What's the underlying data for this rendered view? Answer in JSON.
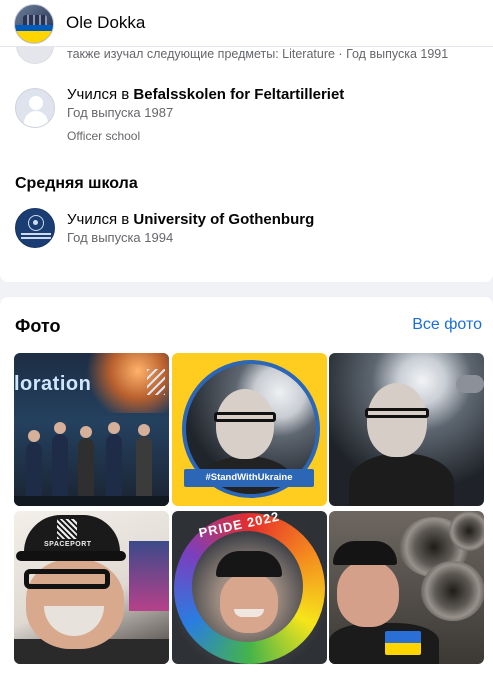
{
  "header": {
    "profile_name": "Ole Dokka"
  },
  "education": {
    "partial_item": "также изучал следующие предметы: Literature · Год выпуска 1991",
    "school_1": {
      "prefix": "Учился в ",
      "name": "Befalsskolen for Feltartilleriet",
      "year": "Год выпуска 1987",
      "note": "Officer school"
    },
    "secondary_title": "Средняя школа",
    "school_2": {
      "prefix": "Учился в ",
      "name": "University of Gothenburg",
      "year": "Год выпуска 1994"
    }
  },
  "photos": {
    "title": "Фото",
    "all_link": "Все фото",
    "items": [
      {
        "icon": "conference-photo",
        "overlay_text": "loration"
      },
      {
        "icon": "standwithukraine-portrait",
        "overlay_text": "#StandWithUkraine"
      },
      {
        "icon": "astronaut-portrait"
      },
      {
        "icon": "spaceport-cap-selfie",
        "overlay_text": "SPACEPORT"
      },
      {
        "icon": "pride-frame-selfie",
        "overlay_text": "PRIDE 2022"
      },
      {
        "icon": "rocket-engine-selfie"
      }
    ]
  },
  "colors": {
    "link": "#1a6ed8",
    "card": "#ffffff",
    "background": "#f0f2f5",
    "ukraine_blue": "#2b66b7",
    "ukraine_yellow": "#ffcd1f"
  }
}
